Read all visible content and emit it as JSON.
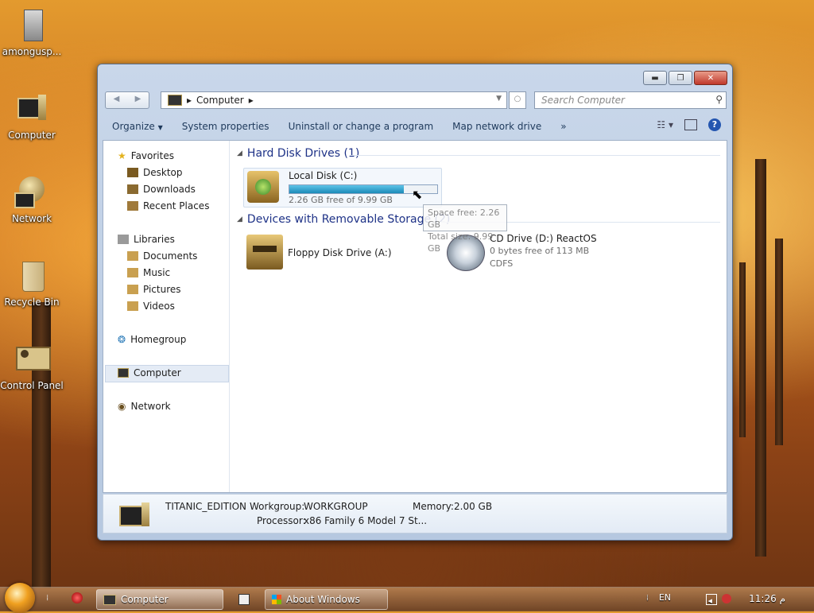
{
  "desktop": {
    "icons": [
      {
        "label": "amongusp..."
      },
      {
        "label": "Computer"
      },
      {
        "label": "Network"
      },
      {
        "label": "Recycle Bin"
      },
      {
        "label": "Control Panel"
      }
    ]
  },
  "window": {
    "caption_buttons": {
      "minimize": "▬",
      "maximize": "❐",
      "close": "✕"
    },
    "nav": {
      "back": "◀",
      "forward": "▶"
    },
    "address": {
      "location": "Computer",
      "separator": "▸"
    },
    "search": {
      "placeholder": "Search Computer"
    },
    "toolbar": {
      "organize": "Organize",
      "system_properties": "System properties",
      "uninstall": "Uninstall or change a program",
      "map_network": "Map network drive",
      "more": "»"
    },
    "navpane": {
      "favorites": "Favorites",
      "desktop": "Desktop",
      "downloads": "Downloads",
      "recent": "Recent Places",
      "libraries": "Libraries",
      "documents": "Documents",
      "music": "Music",
      "pictures": "Pictures",
      "videos": "Videos",
      "homegroup": "Homegroup",
      "computer": "Computer",
      "network": "Network"
    },
    "groups": {
      "hard_disks": "Hard Disk Drives (1)",
      "removable": "Devices with Removable Storage (2)"
    },
    "drives": {
      "local_c": {
        "name": "Local Disk (C:)",
        "free": "2.26 GB free of 9.99 GB",
        "used_fraction": 0.774
      },
      "floppy": {
        "name": "Floppy Disk Drive (A:)"
      },
      "cd": {
        "name": "CD Drive (D:) ReactOS",
        "free": "0 bytes free of 113 MB",
        "fs": "CDFS"
      }
    },
    "tooltip": {
      "line1": "Space free: 2.26 GB",
      "line2": "Total size: 9.99 GB"
    },
    "status": {
      "computer_name": "TITANIC_EDITION",
      "workgroup_label": "Workgroup:",
      "workgroup": "WORKGROUP",
      "memory_label": "Memory:",
      "memory": "2.00 GB",
      "processor_label": "Processor:",
      "processor": "x86 Family 6 Model 7 St..."
    }
  },
  "taskbar": {
    "tasks": [
      {
        "label": "Computer"
      },
      {
        "label": "About Windows"
      }
    ],
    "tray": {
      "lang": "EN",
      "time": "11:26 م"
    }
  },
  "colors": {
    "link_blue": "#1e3287",
    "progress": "#1b8ab8"
  }
}
